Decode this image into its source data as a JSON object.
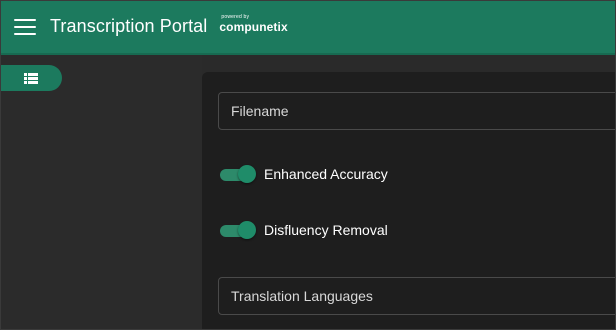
{
  "header": {
    "title": "Transcription Portal",
    "brand_small": "powered by",
    "brand_name": "compunetix"
  },
  "sidebar": {
    "list_button_icon": "list-icon"
  },
  "form": {
    "filename_placeholder": "Filename",
    "enhanced_accuracy": {
      "label": "Enhanced Accuracy",
      "enabled": true
    },
    "disfluency_removal": {
      "label": "Disfluency Removal",
      "enabled": true
    },
    "translation_placeholder": "Translation Languages"
  },
  "colors": {
    "accent": "#1c7a5e",
    "toggle_on": "#2d8a6a",
    "background": "#2a2a2a",
    "panel": "#1e1e1e"
  }
}
